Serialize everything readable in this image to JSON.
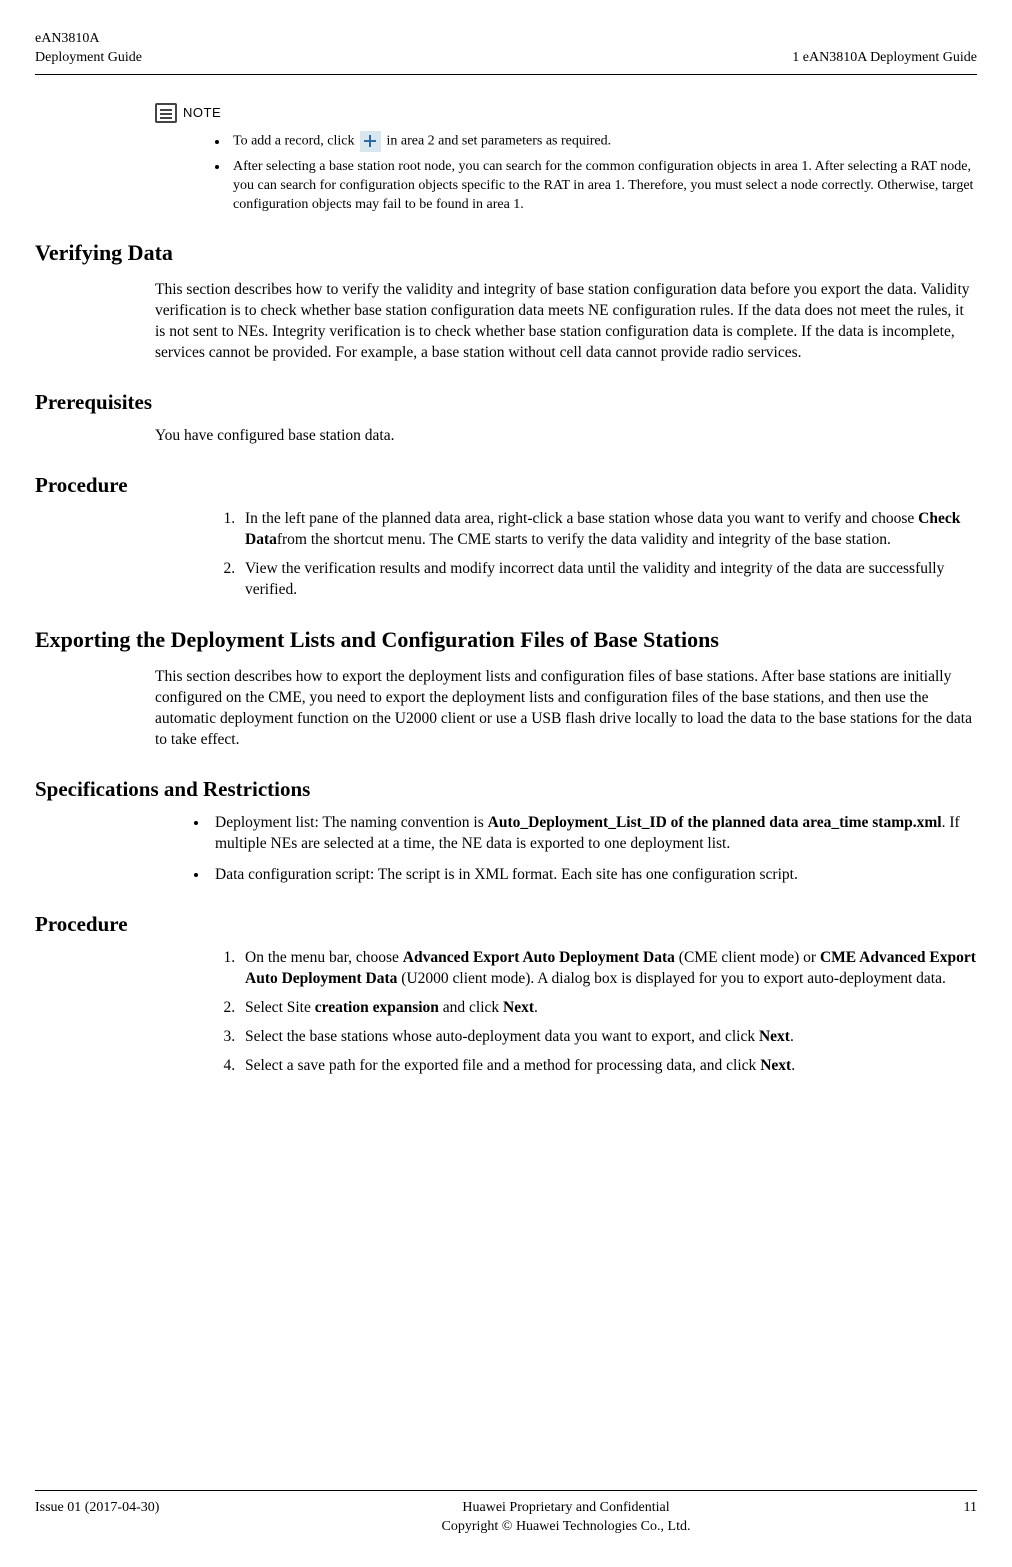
{
  "header": {
    "product": "eAN3810A",
    "doc_left": "Deployment Guide",
    "doc_right": "1 eAN3810A Deployment Guide"
  },
  "note": {
    "label": "NOTE",
    "items": [
      {
        "pre": "To add a record, click ",
        "post": "in area 2 and set parameters as required."
      },
      {
        "text": "After selecting a base station root node, you can search for the common configuration objects in area 1. After selecting a RAT node, you can search for configuration objects specific to the RAT in area 1. Therefore, you must select a node correctly. Otherwise, target configuration objects may fail to be found in area 1."
      }
    ]
  },
  "verifying": {
    "heading": "Verifying Data",
    "para": "This section describes how to verify the validity and integrity of base station configuration data before you export the data. Validity verification is to check whether base station configuration data meets NE configuration rules. If the data does not meet the rules, it is not sent to NEs. Integrity verification is to check whether base station configuration data is complete. If the data is incomplete, services cannot be provided. For example, a base station without cell data cannot provide radio services."
  },
  "prereq": {
    "heading": "Prerequisites",
    "para": "You have configured base station data."
  },
  "procedure1": {
    "heading": "Procedure",
    "steps": [
      {
        "pre": "In the left pane of the planned data area, right-click a base station whose data you want to verify and choose ",
        "bold": "Check Data",
        "post": "from the shortcut menu. The CME starts to verify the data validity and integrity of the base station."
      },
      {
        "text": "View the verification results and modify incorrect data until the validity and integrity of the data are successfully verified."
      }
    ]
  },
  "exporting": {
    "heading": "Exporting the Deployment Lists and Configuration Files of Base Stations",
    "para": "This section describes how to export the deployment lists and configuration files of base stations. After base stations are initially configured on the CME, you need to export the deployment lists and configuration files of the base stations, and then use the automatic deployment function on the U2000 client or use a USB flash drive locally to load the data to the base stations for the data to take effect."
  },
  "specs": {
    "heading": "Specifications and Restrictions",
    "items": [
      {
        "pre": "Deployment list: The naming convention is ",
        "bold": "Auto_Deployment_List_ID of the planned data area_time stamp.xml",
        "post": ". If multiple NEs are selected at a time, the NE data is exported to one deployment list."
      },
      {
        "text": "Data configuration script: The script is in XML format. Each site has one configuration script."
      }
    ]
  },
  "procedure2": {
    "heading": "Procedure",
    "steps": [
      {
        "pre": "On the menu bar, choose ",
        "bold1": "Advanced Export Auto Deployment Data",
        "mid": " (CME client mode) or ",
        "bold2": "CME Advanced Export Auto Deployment Data",
        "post": " (U2000 client mode). A dialog box is displayed for you to export auto-deployment data."
      },
      {
        "pre": "Select Site ",
        "bold1": "creation expansion",
        "mid": " and click ",
        "bold2": "Next",
        "post": "."
      },
      {
        "pre": "Select the base stations whose auto-deployment data you want to export, and click ",
        "bold1": "Next",
        "post": "."
      },
      {
        "pre": "Select a save path for the exported file and a method for processing data, and click ",
        "bold1": "Next",
        "post": "."
      }
    ]
  },
  "footer": {
    "issue": "Issue 01 (2017-04-30)",
    "line1": "Huawei Proprietary and Confidential",
    "line2": "Copyright © Huawei Technologies Co., Ltd.",
    "page": "11"
  }
}
